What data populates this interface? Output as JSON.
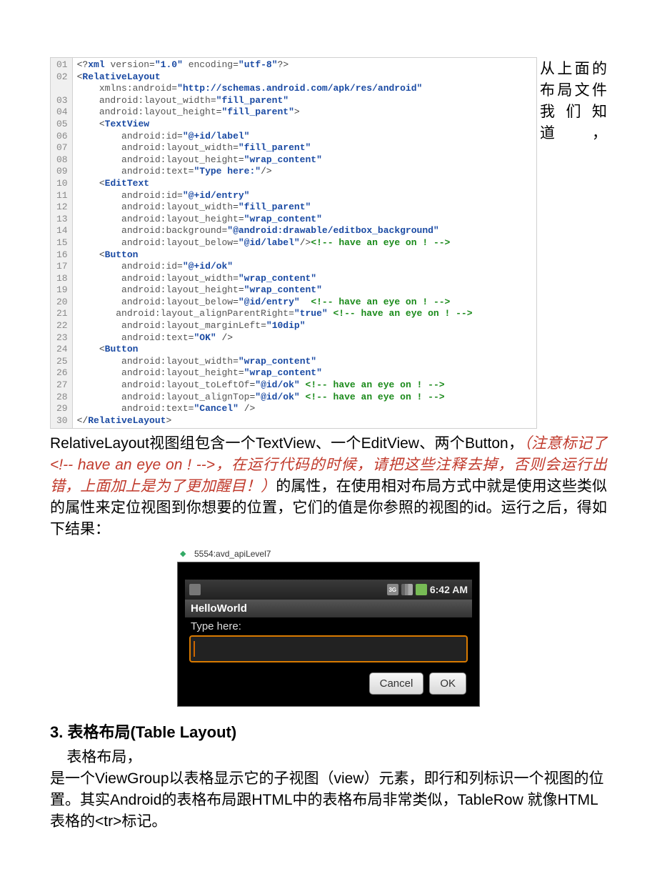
{
  "code": {
    "lines": [
      {
        "n": "01",
        "html": "<span class='punct'>&lt;?</span><span class='xml-decl'>xml</span> <span class='attr'>version</span><span class='punct'>=</span><span class='val'>\"1.0\"</span> <span class='attr'>encoding</span><span class='punct'>=</span><span class='val'>\"utf-8\"</span><span class='punct'>?&gt;</span>"
      },
      {
        "n": "02",
        "html": "<span class='punct'>&lt;</span><span class='tag'>RelativeLayout</span>"
      },
      {
        "n": "  ",
        "html": "    <span class='attr'>xmlns:android</span><span class='punct'>=</span><span class='val'>\"http://schemas.android.com/apk/res/android\"</span>"
      },
      {
        "n": "03",
        "html": "    <span class='attr'>android:layout_width</span><span class='punct'>=</span><span class='val'>\"fill_parent\"</span>"
      },
      {
        "n": "04",
        "html": "    <span class='attr'>android:layout_height</span><span class='punct'>=</span><span class='val'>\"fill_parent\"</span><span class='punct'>&gt;</span>"
      },
      {
        "n": "05",
        "html": "    <span class='punct'>&lt;</span><span class='tag'>TextView</span>"
      },
      {
        "n": "06",
        "html": "        <span class='attr'>android:id</span><span class='punct'>=</span><span class='val'>\"@+id/label\"</span>"
      },
      {
        "n": "07",
        "html": "        <span class='attr'>android:layout_width</span><span class='punct'>=</span><span class='val'>\"fill_parent\"</span>"
      },
      {
        "n": "08",
        "html": "        <span class='attr'>android:layout_height</span><span class='punct'>=</span><span class='val'>\"wrap_content\"</span>"
      },
      {
        "n": "09",
        "html": "        <span class='attr'>android:text</span><span class='punct'>=</span><span class='val'>\"Type here:\"</span><span class='punct'>/&gt;</span>"
      },
      {
        "n": "10",
        "html": "    <span class='punct'>&lt;</span><span class='tag'>EditText</span>"
      },
      {
        "n": "11",
        "html": "        <span class='attr'>android:id</span><span class='punct'>=</span><span class='val'>\"@+id/entry\"</span>"
      },
      {
        "n": "12",
        "html": "        <span class='attr'>android:layout_width</span><span class='punct'>=</span><span class='val'>\"fill_parent\"</span>"
      },
      {
        "n": "13",
        "html": "        <span class='attr'>android:layout_height</span><span class='punct'>=</span><span class='val'>\"wrap_content\"</span>"
      },
      {
        "n": "14",
        "html": "        <span class='attr'>android:background</span><span class='punct'>=</span><span class='val'>\"@android:drawable/editbox_background\"</span>"
      },
      {
        "n": "15",
        "html": "        <span class='attr'>android:layout_below</span><span class='punct'>=</span><span class='val'>\"@id/label\"</span><span class='punct'>/&gt;</span><span class='comment'>&lt;!-- have an eye on ! --&gt;</span>"
      },
      {
        "n": "16",
        "html": "    <span class='punct'>&lt;</span><span class='tag'>Button</span>"
      },
      {
        "n": "17",
        "html": "        <span class='attr'>android:id</span><span class='punct'>=</span><span class='val'>\"@+id/ok\"</span>"
      },
      {
        "n": "18",
        "html": "        <span class='attr'>android:layout_width</span><span class='punct'>=</span><span class='val'>\"wrap_content\"</span>"
      },
      {
        "n": "19",
        "html": "        <span class='attr'>android:layout_height</span><span class='punct'>=</span><span class='val'>\"wrap_content\"</span>"
      },
      {
        "n": "20",
        "html": "        <span class='attr'>android:layout_below</span><span class='punct'>=</span><span class='val'>\"@id/entry\"</span>  <span class='comment'>&lt;!-- have an eye on ! --&gt;</span>"
      },
      {
        "n": "21",
        "html": "       <span class='attr'>android:layout_alignParentRight</span><span class='punct'>=</span><span class='val'>\"true\"</span> <span class='comment'>&lt;!-- have an eye on ! --&gt;</span>"
      },
      {
        "n": "22",
        "html": "        <span class='attr'>android:layout_marginLeft</span><span class='punct'>=</span><span class='val'>\"10dip\"</span>"
      },
      {
        "n": "23",
        "html": "        <span class='attr'>android:text</span><span class='punct'>=</span><span class='val'>\"OK\"</span> <span class='punct'>/&gt;</span>"
      },
      {
        "n": "24",
        "html": "    <span class='punct'>&lt;</span><span class='tag'>Button</span>"
      },
      {
        "n": "25",
        "html": "        <span class='attr'>android:layout_width</span><span class='punct'>=</span><span class='val'>\"wrap_content\"</span>"
      },
      {
        "n": "26",
        "html": "        <span class='attr'>android:layout_height</span><span class='punct'>=</span><span class='val'>\"wrap_content\"</span>"
      },
      {
        "n": "27",
        "html": "        <span class='attr'>android:layout_toLeftOf</span><span class='punct'>=</span><span class='val'>\"@id/ok\"</span> <span class='comment'>&lt;!-- have an eye on ! --&gt;</span>"
      },
      {
        "n": "28",
        "html": "        <span class='attr'>android:layout_alignTop</span><span class='punct'>=</span><span class='val'>\"@id/ok\"</span> <span class='comment'>&lt;!-- have an eye on ! --&gt;</span>"
      },
      {
        "n": "29",
        "html": "        <span class='attr'>android:text</span><span class='punct'>=</span><span class='val'>\"Cancel\"</span> <span class='punct'>/&gt;</span>"
      },
      {
        "n": "30",
        "html": "<span class='punct'>&lt;/</span><span class='tag'>RelativeLayout</span><span class='punct'>&gt;</span>"
      }
    ]
  },
  "para1_lead": "从上面的布局文件我们知道，RelativeLayout视图组包含一个TextView、一个EditView、两个Button，",
  "para1_red": "（注意标记了<!-- have an eye on ! -->，在运行代码的时候，请把这些注释去掉，否则会运行出错，上面加上是为了更加醒目！）",
  "para1_tail": "的属性，在使用相对布局方式中就是使用这些类似的属性来定位视图到你想要的位置，它们的值是你参照的视图的id。运行之后，得如下结果：",
  "emulator": {
    "title": "5554:avd_apiLevel7",
    "clock": "6:42 AM",
    "app_title": "HelloWorld",
    "label": "Type here:",
    "btn_cancel": "Cancel",
    "btn_ok": "OK"
  },
  "section": {
    "heading": "3.  表格布局(Table Layout)",
    "indent_text": "    表格布局，",
    "body": "是一个ViewGroup以表格显示它的子视图（view）元素，即行和列标识一个视图的位置。其实Android的表格布局跟HTML中的表格布局非常类似，TableRow 就像HTML表格的<tr>标记。"
  }
}
